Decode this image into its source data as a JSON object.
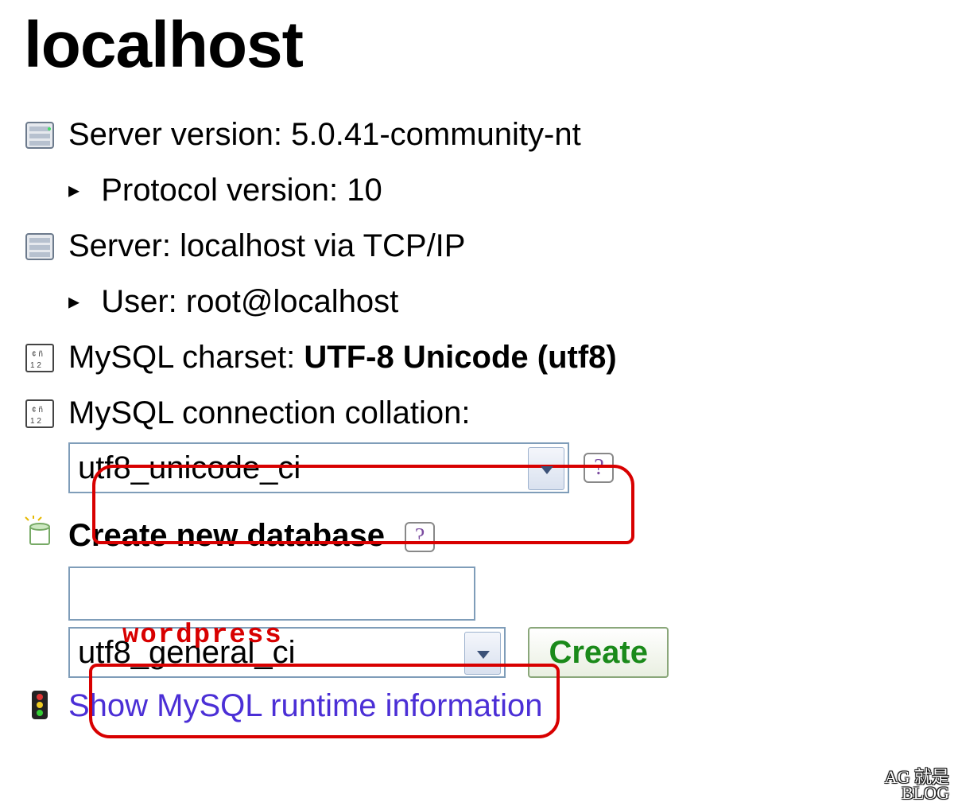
{
  "title": "localhost",
  "info": {
    "server_version_label": "Server version:",
    "server_version_value": "5.0.41-community-nt",
    "protocol_label": "Protocol version:",
    "protocol_value": "10",
    "server_label": "Server:",
    "server_value": "localhost via TCP/IP",
    "user_label": "User:",
    "user_value": "root@localhost",
    "charset_label": "MySQL charset:",
    "charset_value": "UTF-8 Unicode (utf8)",
    "collation_label": "MySQL connection collation:"
  },
  "collation_select_value": "utf8_unicode_ci",
  "create_db": {
    "heading": "Create new database",
    "name_value": "",
    "collation_value": "utf8_general_ci",
    "button_label": "Create"
  },
  "links": {
    "runtime_info": "Show MySQL runtime information"
  },
  "annotation": "wordpress",
  "help_glyph": "?"
}
